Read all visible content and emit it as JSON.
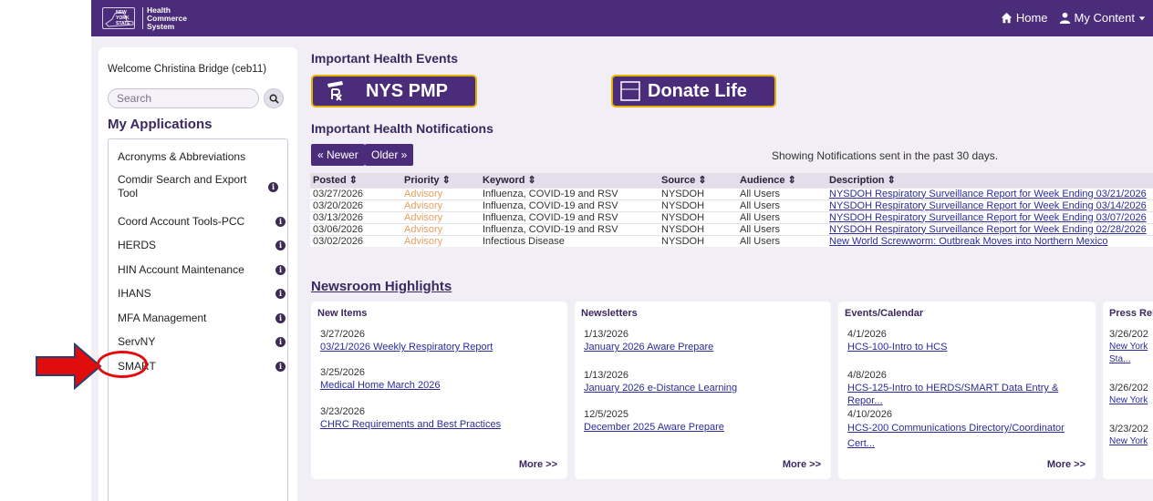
{
  "header": {
    "logo_state": "NEW YORK STATE",
    "logo_lines": [
      "Health",
      "Commerce",
      "System"
    ],
    "nav": {
      "home": "Home",
      "my_content": "My Content"
    }
  },
  "sidebar": {
    "welcome": "Welcome Christina Bridge (ceb11)",
    "search_placeholder": "Search",
    "apps_heading": "My Applications",
    "items": [
      "Acronyms & Abbreviations",
      "Comdir Search and Export Tool",
      "Coord Account Tools-PCC",
      "HERDS",
      "HIN Account Maintenance",
      "IHANS",
      "MFA Management",
      "ServNY",
      "SMART"
    ]
  },
  "events": {
    "heading": "Important Health Events",
    "banner_pmp": "NYS PMP",
    "banner_donate": "Donate Life",
    "donate_icon_top": "DONATE",
    "donate_icon_bottom": "LIFE"
  },
  "notifications": {
    "heading": "Important Health Notifications",
    "newer": "« Newer",
    "older": "Older »",
    "showing": "Showing Notifications sent in the past 30 days.",
    "columns": [
      "Posted ⇕",
      "Priority ⇕",
      "Keyword ⇕",
      "Source ⇕",
      "Audience ⇕",
      "Description ⇕"
    ],
    "rows": [
      [
        "03/27/2026",
        "Advisory",
        "Influenza, COVID-19 and RSV",
        "NYSDOH",
        "All Users",
        "NYSDOH Respiratory Surveillance Report for Week Ending 03/21/2026"
      ],
      [
        "03/20/2026",
        "Advisory",
        "Influenza, COVID-19 and RSV",
        "NYSDOH",
        "All Users",
        "NYSDOH Respiratory Surveillance Report for Week Ending 03/14/2026"
      ],
      [
        "03/13/2026",
        "Advisory",
        "Influenza, COVID-19 and RSV",
        "NYSDOH",
        "All Users",
        "NYSDOH Respiratory Surveillance Report for Week Ending 03/07/2026"
      ],
      [
        "03/06/2026",
        "Advisory",
        "Influenza, COVID-19 and RSV",
        "NYSDOH",
        "All Users",
        "NYSDOH Respiratory Surveillance Report for Week Ending 02/28/2026"
      ],
      [
        "03/02/2026",
        "Advisory",
        "Infectious Disease",
        "NYSDOH",
        "All Users",
        "New World Screwworm: Outbreak Moves into Northern Mexico"
      ]
    ]
  },
  "newsroom": {
    "heading": "Newsroom Highlights",
    "more": "More >>",
    "cards": [
      {
        "title": "New Items",
        "entries": [
          {
            "date": "3/27/2026",
            "link": "03/21/2026 Weekly Respiratory Report"
          },
          {
            "date": "3/25/2026",
            "link": "Medical Home March 2026"
          },
          {
            "date": "3/23/2026",
            "link": "CHRC Requirements and Best Practices"
          }
        ]
      },
      {
        "title": "Newsletters",
        "entries": [
          {
            "date": "1/13/2026",
            "link": "January 2026 Aware Prepare"
          },
          {
            "date": "1/13/2026",
            "link": "January 2026 e-Distance Learning"
          },
          {
            "date": "12/5/2025",
            "link": "December 2025 Aware Prepare"
          }
        ]
      },
      {
        "title": "Events/Calendar",
        "entries": [
          {
            "date": "4/1/2026",
            "link": "HCS-100-Intro to HCS"
          },
          {
            "date": "4/8/2026",
            "link": "HCS-125-Intro to HERDS/SMART Data Entry & Repor..."
          },
          {
            "date": "4/10/2026",
            "link": "HCS-200 Communications Directory/Coordinator Cert..."
          }
        ]
      },
      {
        "title": "Press Rel",
        "entries": [
          {
            "date": "3/26/202",
            "link": "New York Sta..."
          },
          {
            "date": "3/26/202",
            "link": "New York"
          },
          {
            "date": "3/23/202",
            "link": "New York"
          }
        ]
      }
    ]
  },
  "colors": {
    "brand_purple": "#4b2c7a",
    "banner_gold": "#e5b100",
    "advisory": "#e8a060",
    "annotation_red": "#e10d0d"
  }
}
